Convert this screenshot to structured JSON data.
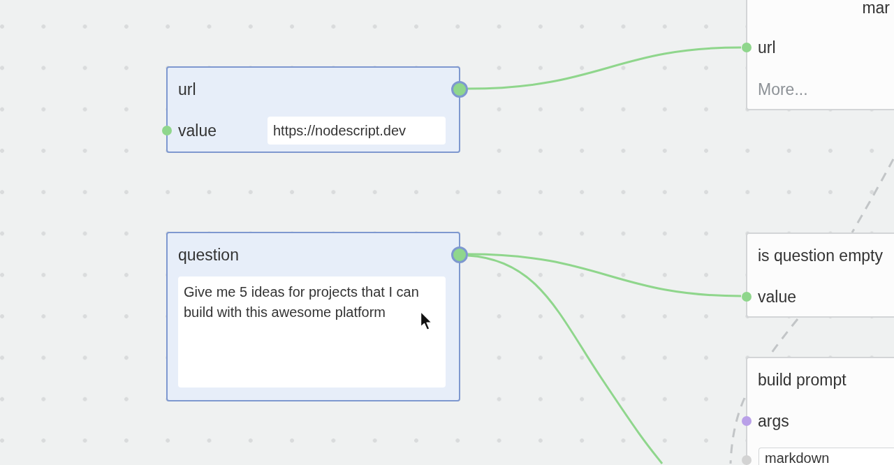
{
  "canvas": {
    "nodes": [
      {
        "title": "url",
        "selected": true,
        "params": [
          {
            "kind": "text",
            "label": "value",
            "value": "https://nodescript.dev",
            "color": "#8fd68c"
          }
        ]
      },
      {
        "title": "question",
        "selected": true,
        "params": [
          {
            "kind": "textarea",
            "value": "Give me 5 ideas for projects that I can build with this awesome platform"
          }
        ]
      },
      {
        "title": "mar",
        "selected": false,
        "params": [
          {
            "kind": "socket",
            "label": "url",
            "color": "#8fd68c"
          }
        ],
        "more": "More..."
      },
      {
        "title": "is question empty",
        "selected": false,
        "params": [
          {
            "kind": "socket",
            "label": "value",
            "color": "#8fd68c"
          }
        ]
      },
      {
        "title": "build prompt",
        "selected": false,
        "params": [
          {
            "kind": "socket",
            "label": "args",
            "color": "#b9a0e8"
          },
          {
            "kind": "field",
            "value": "markdown",
            "color": "#d3d3d3"
          }
        ]
      }
    ]
  }
}
